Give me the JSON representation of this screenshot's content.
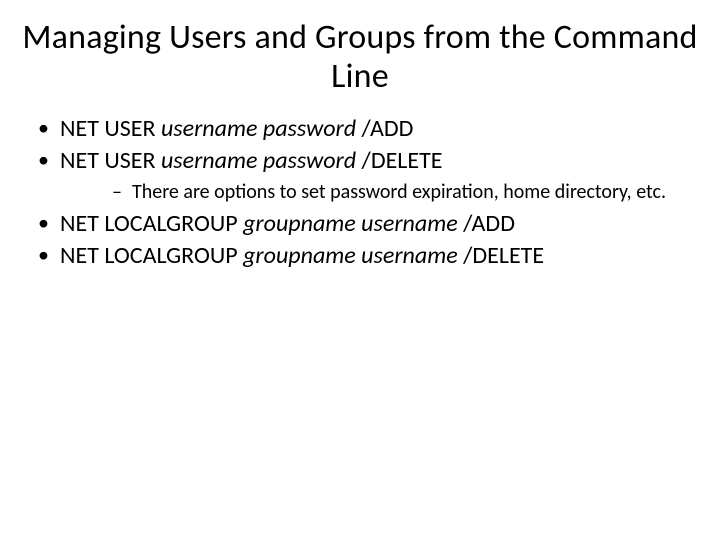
{
  "title": "Managing Users and Groups from the Command Line",
  "bullets": {
    "b0": {
      "prefix": "NET USER ",
      "italic": "username password",
      "suffix": " /ADD"
    },
    "b1": {
      "prefix": "NET USER ",
      "italic": "username password",
      "suffix": " /DELETE"
    },
    "sub0": "There are options to set password expiration, home directory, etc.",
    "b2": {
      "prefix": "NET LOCALGROUP ",
      "italic": "groupname username",
      "suffix": " /ADD"
    },
    "b3": {
      "prefix": "NET LOCALGROUP ",
      "italic": "groupname username",
      "suffix": " /DELETE"
    }
  }
}
